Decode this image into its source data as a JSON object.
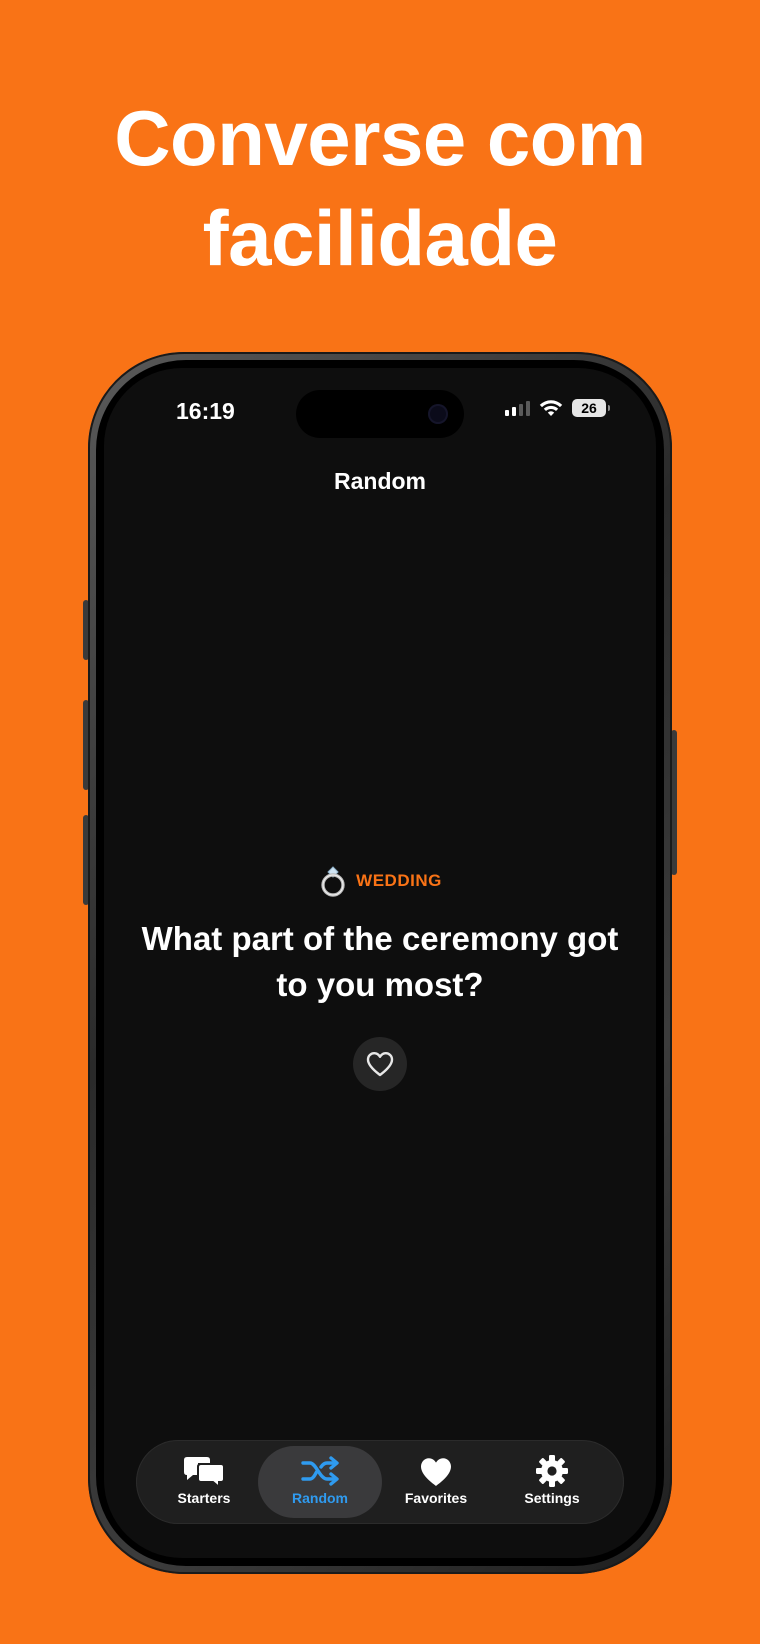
{
  "headline": {
    "line1": "Converse com",
    "line2": "facilidade"
  },
  "status_bar": {
    "time": "16:19",
    "battery": "26"
  },
  "screen": {
    "title": "Random",
    "category": {
      "icon": "ring-icon",
      "label": "WEDDING"
    },
    "question": "What part of the ceremony got to you most?",
    "favorite_icon": "heart-outline-icon"
  },
  "tabbar": {
    "active": "Random",
    "tabs": [
      {
        "label": "Starters",
        "icon": "speech-bubbles-icon"
      },
      {
        "label": "Random",
        "icon": "shuffle-icon"
      },
      {
        "label": "Favorites",
        "icon": "heart-icon"
      },
      {
        "label": "Settings",
        "icon": "gear-icon"
      }
    ]
  },
  "colors": {
    "background": "#F97316",
    "accent": "#F97316",
    "active_tab": "#2F9BF0",
    "screen": "#0E0E0E"
  }
}
